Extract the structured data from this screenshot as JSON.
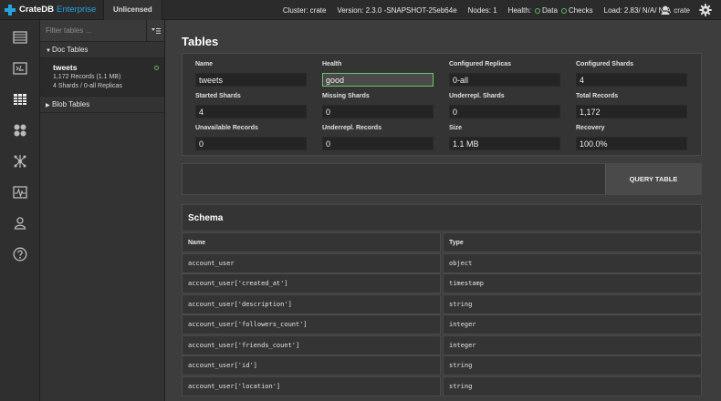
{
  "topbar": {
    "brand_name": "CrateDB",
    "brand_edition": "Enterprise",
    "license": "Unlicensed",
    "cluster": "Cluster: crate",
    "version": "Version: 2.3.0 -SNAPSHOT-25eb64e",
    "nodes": "Nodes: 1",
    "health_label": "Health:",
    "health_data": "Data",
    "health_checks": "Checks",
    "load": "Load: 2.83/ N/A/ N/A",
    "user": "crate",
    "accent": "#27a3e0",
    "status_color": "#5cb85c"
  },
  "nav_icons": [
    "overview-icon",
    "console-icon",
    "tables-icon",
    "views-icon",
    "cluster-icon",
    "monitoring-icon",
    "users-icon",
    "help-icon"
  ],
  "sidebar": {
    "filter_placeholder": "Filter tables ...",
    "doc_section": "Doc Tables",
    "blob_section": "Blob Tables",
    "table": {
      "name": "tweets",
      "records": "1,172 Records (1.1 MB)",
      "shards": "4 Shards / 0-all Replicas"
    }
  },
  "main": {
    "title": "Tables",
    "fields": [
      {
        "label": "Name",
        "value": "tweets"
      },
      {
        "label": "Health",
        "value": "good"
      },
      {
        "label": "Configured Replicas",
        "value": "0-all"
      },
      {
        "label": "Configured Shards",
        "value": "4"
      },
      {
        "label": "Started Shards",
        "value": "4"
      },
      {
        "label": "Missing Shards",
        "value": "0"
      },
      {
        "label": "Underrepl. Shards",
        "value": "0"
      },
      {
        "label": "Total Records",
        "value": "1,172"
      },
      {
        "label": "Unavailable Records",
        "value": "0"
      },
      {
        "label": "Underrepl. Records",
        "value": "0"
      },
      {
        "label": "Size",
        "value": "1.1 MB"
      },
      {
        "label": "Recovery",
        "value": "100.0%"
      }
    ],
    "query_button": "QUERY TABLE",
    "schema_title": "Schema",
    "columns": [
      "Name",
      "Type"
    ],
    "rows": [
      {
        "name": "account_user",
        "type": "object"
      },
      {
        "name": "account_user['created_at']",
        "type": "timestamp"
      },
      {
        "name": "account_user['description']",
        "type": "string"
      },
      {
        "name": "account_user['followers_count']",
        "type": "integer"
      },
      {
        "name": "account_user['friends_count']",
        "type": "integer"
      },
      {
        "name": "account_user['id']",
        "type": "string"
      },
      {
        "name": "account_user['location']",
        "type": "string"
      }
    ]
  }
}
